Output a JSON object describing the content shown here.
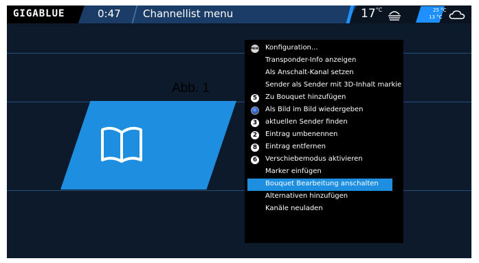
{
  "header": {
    "logo": "GIGABLUE",
    "time": "0:47",
    "title": "Channellist menu",
    "temperature": "17",
    "temperature_unit": "°C",
    "temp_max": "25 °C",
    "temp_min": "13 °C",
    "weather_now_icon": "fog-icon",
    "weather_forecast_icon": "cloud-icon"
  },
  "annotation": "Abb. 1",
  "tile_icon": "book-icon",
  "menu": {
    "items": [
      {
        "key": "MENU",
        "icon": "menu-key-icon",
        "label": "Konfiguration..."
      },
      {
        "key": "",
        "label": "Transponder-Info anzeigen"
      },
      {
        "key": "",
        "label": "Als Anschalt-Kanal setzen"
      },
      {
        "key": "",
        "label": "Sender als Sender mit 3D-Inhalt markie"
      },
      {
        "key": "5",
        "label": "Zu Bouquet hinzufügen"
      },
      {
        "key": "",
        "icon": "blue-button-icon",
        "label": "Als Bild im Bild wiedergeben"
      },
      {
        "key": "3",
        "label": "aktuellen Sender finden"
      },
      {
        "key": "2",
        "label": "Eintrag umbenennen"
      },
      {
        "key": "8",
        "label": "Eintrag entfernen"
      },
      {
        "key": "6",
        "label": "Verschiebemodus aktivieren"
      },
      {
        "key": "",
        "label": "Marker einfügen"
      },
      {
        "key": "",
        "label": "Bouquet Bearbeitung anschalten",
        "selected": true
      },
      {
        "key": "",
        "label": "Alternativen hinzufügen"
      },
      {
        "key": "",
        "label": "Kanäle neuladen"
      }
    ]
  },
  "colors": {
    "background": "#0d1a2c",
    "topbar": "#1b3c66",
    "accent": "#1e8fe0",
    "menu_bg": "#000000"
  }
}
